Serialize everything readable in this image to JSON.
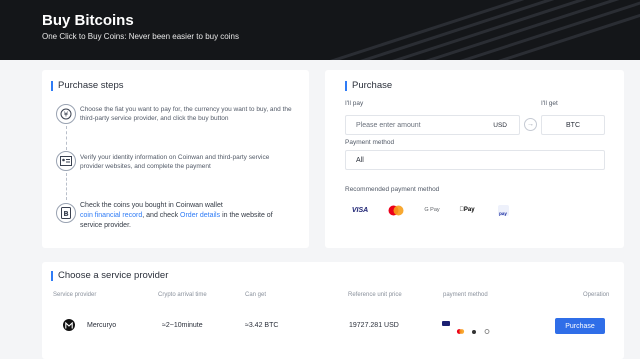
{
  "hero": {
    "title": "Buy Bitcoins",
    "subtitle": "One Click to Buy Coins: Never been easier to buy coins"
  },
  "steps": {
    "title": "Purchase steps",
    "items": [
      {
        "icon": "currency-exchange-icon",
        "text": "Choose the fiat you want to pay for, the currency you want to buy, and the third-party service provider, and click the buy button"
      },
      {
        "icon": "id-card-icon",
        "text": "Verify your identity information on Coinwan and third-party service provider websites, and complete the payment"
      },
      {
        "icon": "wallet-icon",
        "text_before": "Check the coins you bought in Coinwan wallet",
        "link1": "coin financial record",
        "text_mid": ", and check",
        "link2": "Order details",
        "text_after": "in the website of service provider."
      }
    ]
  },
  "purchase": {
    "title": "Purchase",
    "pay_label": "I'll pay",
    "get_label": "I'll get",
    "amount_placeholder": "Please enter amount",
    "pay_currency": "USD",
    "get_currency": "BTC",
    "method_label": "Payment method",
    "method_value": "All",
    "recommended_label": "Recommended payment method",
    "recommended": [
      {
        "name": "VISA",
        "icon": "visa-icon",
        "color": "#1a1f71"
      },
      {
        "name": "",
        "icon": "mastercard-icon"
      },
      {
        "name": "G Pay",
        "icon": "google-pay-icon",
        "color": "#5f6368"
      },
      {
        "name": "Pay",
        "icon": "apple-pay-icon",
        "color": "#000000"
      },
      {
        "name": "pay",
        "icon": "samsung-pay-icon",
        "color": "#1428a0"
      }
    ]
  },
  "provider": {
    "title": "Choose a service provider",
    "columns": [
      "Service provider",
      "Crypto arrival time",
      "Can get",
      "Reference unit price",
      "payment method",
      "Operation"
    ],
    "rows": [
      {
        "name": "Mercuryo",
        "arrival": "≈2~10minute",
        "can_get": "≈3.42 BTC",
        "unit_price": "19727.281 USD",
        "button": "Purchase"
      }
    ]
  },
  "colors": {
    "accent": "#2f7cf6",
    "button": "#2f6ee8",
    "hero_bg": "#141619"
  }
}
